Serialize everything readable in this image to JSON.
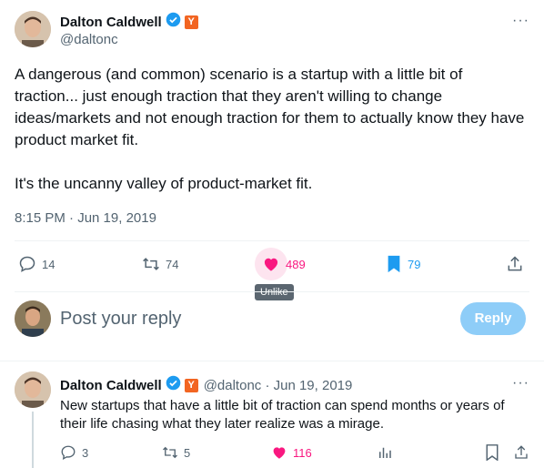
{
  "main_tweet": {
    "author_name": "Dalton Caldwell",
    "author_handle": "@daltonc",
    "badge_letter": "Y",
    "more_label": "···",
    "text_para1": "A dangerous (and common) scenario is a startup with a little bit of traction... just enough traction that they aren't willing to change ideas/markets and not enough traction for them to actually know they have product market fit.",
    "text_para2": "It's the uncanny valley of product-market fit.",
    "timestamp": "8:15 PM · Jun 19, 2019",
    "replies_count": "14",
    "retweets_count": "74",
    "likes_count": "489",
    "bookmarks_count": "79",
    "tooltip": "Unlike"
  },
  "composer": {
    "placeholder": "Post your reply",
    "button_label": "Reply"
  },
  "reply_tweet": {
    "author_name": "Dalton Caldwell",
    "badge_letter": "Y",
    "handle_date": "@daltonc · Jun 19, 2019",
    "more_label": "···",
    "text": "New startups that have a little bit of traction can spend months or years of their life chasing what they later realize was a mirage.",
    "replies_count": "3",
    "retweets_count": "5",
    "likes_count": "116"
  },
  "colors": {
    "like_pink": "#f91880",
    "bookmark_blue": "#1d9bf0",
    "verified_blue": "#1d9bf0",
    "y_orange": "#f26522"
  }
}
